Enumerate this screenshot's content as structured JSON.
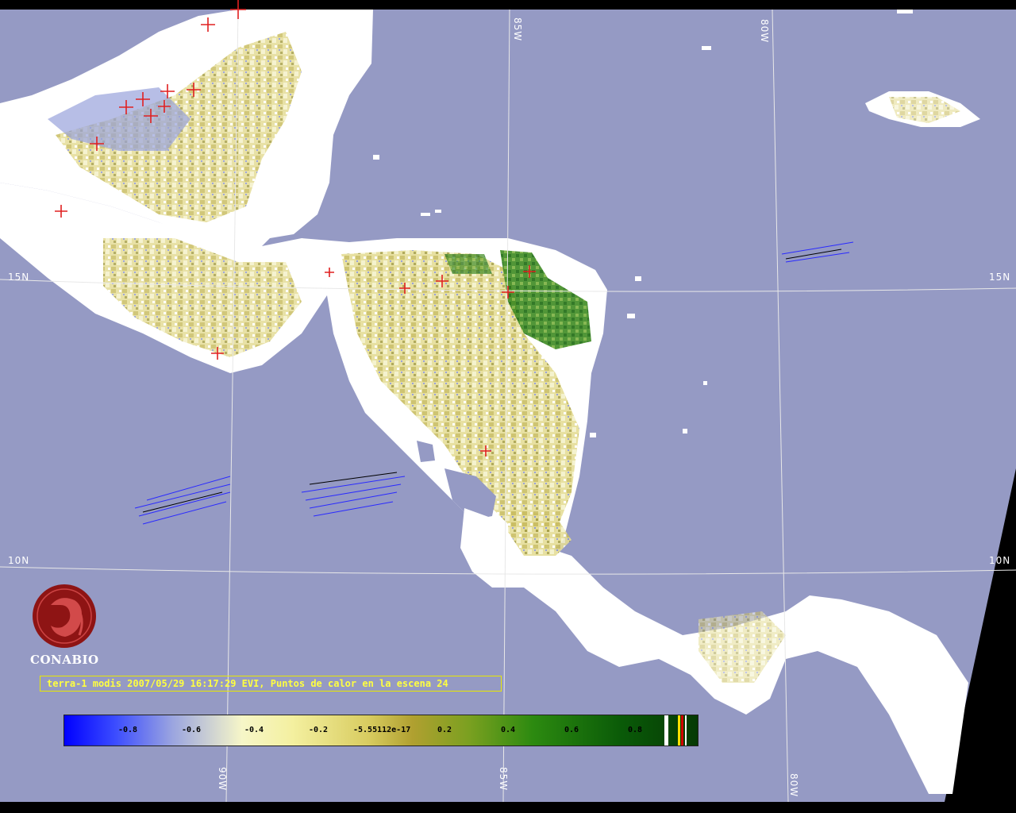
{
  "caption": "terra-1 modis 2007/05/29 16:17:29 EVI, Puntos de calor en la escena 24",
  "organization": "CONABIO",
  "grid_labels": {
    "lon_85w_top": "85W",
    "lon_80w_top": "80W",
    "lat_15n_left": "15N",
    "lat_15n_right": "15N",
    "lat_10n_left": "10N",
    "lat_10n_right": "10N",
    "lon_90w_bottom": "90W",
    "lon_85w_bottom": "85W",
    "lon_80w_bottom": "80W"
  },
  "colorbar": {
    "labels": [
      "-0.8",
      "-0.6",
      "-0.4",
      "-0.2",
      "-5.55112e-17",
      "0.2",
      "0.4",
      "0.6",
      "0.8"
    ]
  },
  "colors": {
    "ocean": "#959ac4",
    "cloud": "#ffffff",
    "hotspot": "#e02020",
    "grid": "#e8e8e8",
    "caption": "#ffff40"
  },
  "icons": {
    "logo": "conabio-logo-icon",
    "hotspot": "hotspot-cross-icon"
  }
}
